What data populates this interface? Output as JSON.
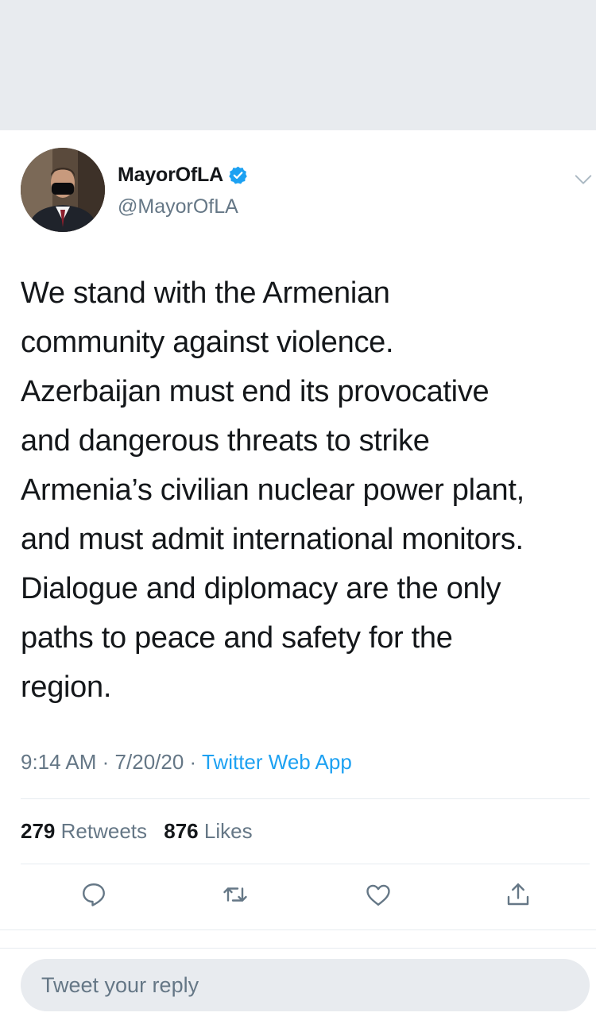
{
  "tweet": {
    "author": {
      "display_name": "MayorOfLA",
      "handle": "@MayorOfLA",
      "verified": true
    },
    "text_lines": [
      "We stand with the Armenian",
      "community against violence.",
      "Azerbaijan must end its provocative",
      "and dangerous threats to strike",
      "Armenia’s civilian nuclear power plant,",
      "and must admit international monitors.",
      "Dialogue and diplomacy are the only",
      "paths to peace and safety for the",
      "region."
    ],
    "meta": {
      "time": "9:14 AM",
      "separator": "·",
      "date": "7/20/20",
      "source": "Twitter Web App"
    },
    "stats": {
      "retweets_count": "279",
      "retweets_label": "Retweets",
      "likes_count": "876",
      "likes_label": "Likes"
    },
    "actions": [
      "reply-icon",
      "retweet-icon",
      "like-icon",
      "share-icon"
    ]
  },
  "reply": {
    "placeholder": "Tweet your reply"
  },
  "colors": {
    "accent": "#1da1f2",
    "text_primary": "#14171a",
    "text_secondary": "#657786",
    "band": "#e8ebef"
  }
}
